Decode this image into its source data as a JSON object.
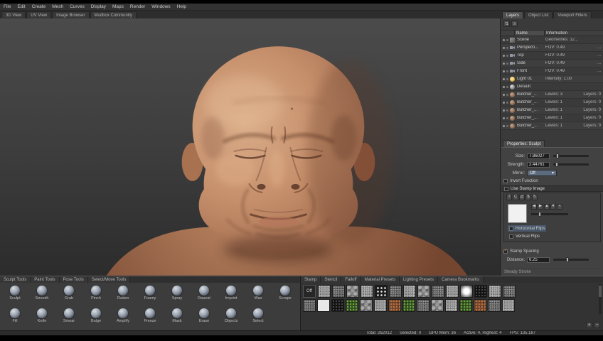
{
  "menubar": {
    "items": [
      "File",
      "Edit",
      "Create",
      "Mesh",
      "Curves",
      "Display",
      "Maps",
      "Render",
      "Windows",
      "Help"
    ]
  },
  "view_tabs": {
    "items": [
      "3D View",
      "UV View",
      "Image Browser",
      "Mudbox Community"
    ]
  },
  "right_panel": {
    "tabs": [
      "Layers",
      "Object List",
      "Viewport Filters"
    ],
    "toolbar_icons": [
      {
        "name": "sort-icon",
        "glyph": "⇅"
      },
      {
        "name": "list-icon",
        "glyph": "≡"
      }
    ],
    "object_list": {
      "columns": {
        "name": "Name",
        "info": "Information"
      },
      "rows": [
        {
          "icon": "scene",
          "name": "Scene",
          "info": "Geometries: 12...",
          "extra": ""
        },
        {
          "icon": "camera",
          "name": "Perspecti...",
          "info": "FOV: 0.49",
          "extra": "..."
        },
        {
          "icon": "camera",
          "name": "Top",
          "info": "FOV: 0.49",
          "extra": "..."
        },
        {
          "icon": "camera",
          "name": "Side",
          "info": "FOV: 0.49",
          "extra": "..."
        },
        {
          "icon": "camera",
          "name": "Front",
          "info": "FOV: 0.49",
          "extra": "..."
        },
        {
          "icon": "light",
          "name": "Light 01",
          "info": "Intensity: 1.00",
          "extra": ""
        },
        {
          "icon": "material",
          "name": "Default",
          "info": "",
          "extra": ""
        },
        {
          "icon": "mesh",
          "name": "Butcher_...",
          "info": "Levels: 3",
          "extra": "Layers: 0"
        },
        {
          "icon": "mesh",
          "name": "Butcher_...",
          "info": "Levels: 1",
          "extra": "Layers: 0"
        },
        {
          "icon": "mesh",
          "name": "Butcher_...",
          "info": "Levels: 1",
          "extra": "Layers: 0"
        },
        {
          "icon": "mesh",
          "name": "Butcher_...",
          "info": "Levels: 1",
          "extra": "Layers: 0"
        },
        {
          "icon": "mesh",
          "name": "Butcher_...",
          "info": "Levels: 1",
          "extra": "Layers: 0"
        }
      ]
    },
    "properties": {
      "tab": "Properties: Sculpt",
      "size_label": "Size:",
      "size_value": "7.86027",
      "strength_label": "Strength:",
      "strength_value": "2.44761",
      "mirror_label": "Mirror:",
      "mirror_value": "Off",
      "mirror_arrow": "▾",
      "invert_label": "Invert Function",
      "use_stamp_label": "Use Stamp Image",
      "stamp_toolbar": [
        "?",
        "C",
        "⇄",
        "⇅",
        "↻"
      ],
      "stamp_side_buttons": [
        "◀",
        "▶",
        "▲",
        "▼",
        "+"
      ],
      "flip_row_1": "Horizontal Flips",
      "flip_row_2": "Vertical Flips",
      "check_glyph": "✓",
      "stamp_spacing_label": "Stamp Spacing",
      "distance_label": "Distance:",
      "distance_value": "6.25",
      "steady_stroke_label": "Steady Stroke"
    }
  },
  "tool_tray": {
    "tabs": [
      "Sculpt Tools",
      "Paint Tools",
      "Pose Tools",
      "Select/Move Tools"
    ],
    "row1": [
      "Sculpt",
      "Smooth",
      "Grab",
      "Pinch",
      "Flatten",
      "Foamy",
      "Spray",
      "Repeat",
      "Imprint",
      "Wax",
      "Scrape"
    ],
    "row2": [
      "Fill",
      "Knife",
      "Smear",
      "Bulge",
      "Amplify",
      "Freeze",
      "Mask",
      "Erase",
      "Objects",
      "Select"
    ]
  },
  "stamp_tray": {
    "tabs": [
      "Stamp",
      "Stencil",
      "Falloff",
      "Material Presets",
      "Lighting Presets",
      "Camera Bookmarks"
    ],
    "off_label": "Off",
    "row1": [
      "noise-light",
      "noise-dark",
      "stones",
      "noise-light",
      "dots-black",
      "noise-dark",
      "noise-light",
      "stones",
      "noise-dark",
      "noise-light",
      "blob-white",
      "solid-black",
      "noise-light",
      "noise-dark"
    ],
    "row2": [
      "noise-dark",
      "solid-white",
      "solid-black",
      "green",
      "stones",
      "noise-light",
      "rust",
      "green",
      "noise-dark",
      "stones",
      "noise-light",
      "green",
      "rust",
      "noise-dark",
      "noise-light"
    ],
    "zoom_in": "+",
    "zoom_out": "−"
  },
  "statusbar": {
    "segments": [
      "Total: 262012",
      "Selected: 0",
      "GPU Mem: 36",
      "Active: 4, Highest: 4",
      "FPS: 135.187"
    ]
  },
  "colors": {
    "accent_check": "#f0a030",
    "skin": "#c68f6b",
    "panel": "#3a3a3a"
  }
}
